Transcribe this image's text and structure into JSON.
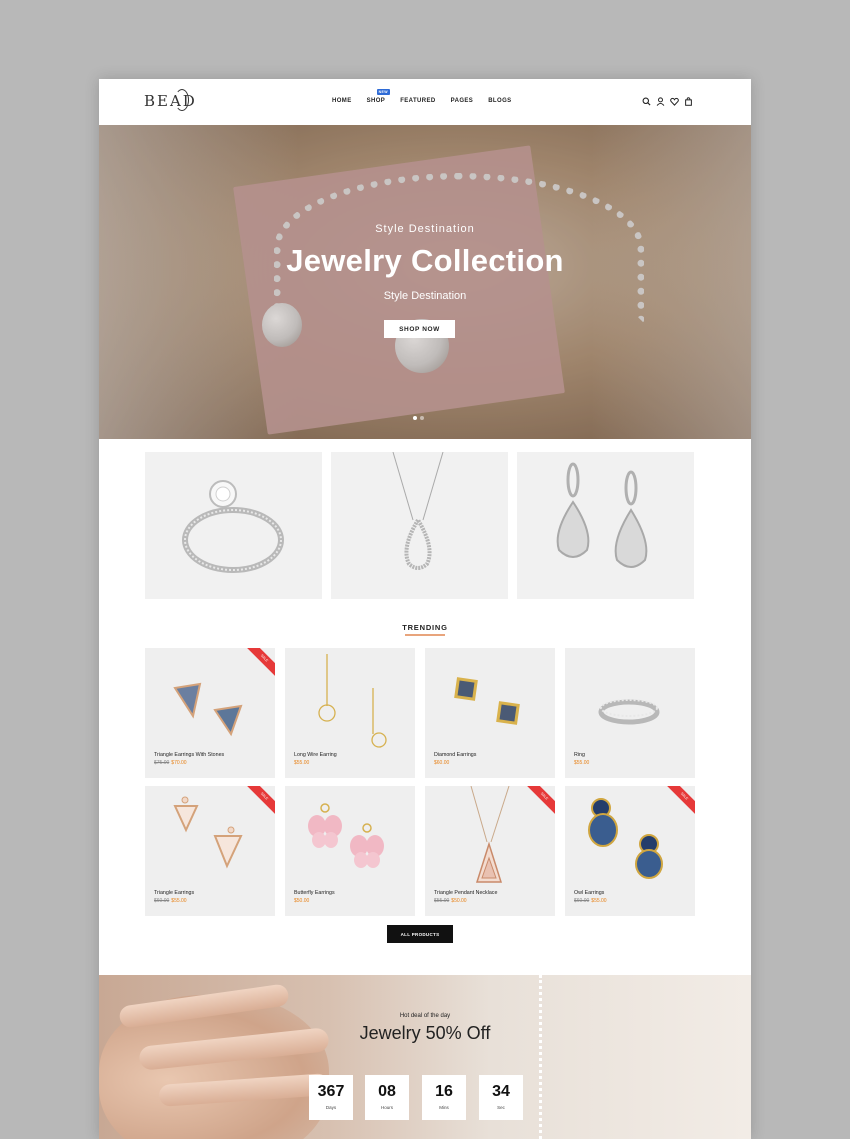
{
  "header": {
    "logo": "BEAD",
    "nav": [
      {
        "label": "HOME"
      },
      {
        "label": "SHOP",
        "badge": "NEW"
      },
      {
        "label": "FEATURED"
      },
      {
        "label": "PAGES"
      },
      {
        "label": "BLOGS"
      }
    ],
    "icons": [
      "search-icon",
      "user-icon",
      "heart-icon",
      "cart-icon"
    ]
  },
  "hero": {
    "kicker": "Style Destination",
    "title": "Jewelry Collection",
    "subtitle": "Style Destination",
    "button": "SHOP NOW",
    "slides": 2,
    "active_slide": 1
  },
  "categories": [
    "ring",
    "necklace",
    "earrings"
  ],
  "trending": {
    "title": "TRENDING",
    "products": [
      {
        "name": "Triangle Earrings With Stones",
        "old_price": "$75.00",
        "price": "$70.00",
        "sale": true
      },
      {
        "name": "Long Wire Earring",
        "old_price": "",
        "price": "$55.00",
        "sale": false
      },
      {
        "name": "Diamond Earrings",
        "old_price": "",
        "price": "$60.00",
        "sale": false
      },
      {
        "name": "Ring",
        "old_price": "",
        "price": "$55.00",
        "sale": false
      },
      {
        "name": "Triangle Earrings",
        "old_price": "$60.00",
        "price": "$55.00",
        "sale": true
      },
      {
        "name": "Butterfly Earrings",
        "old_price": "",
        "price": "$50.00",
        "sale": false
      },
      {
        "name": "Triangle Pendant Necklace",
        "old_price": "$55.00",
        "price": "$50.00",
        "sale": true
      },
      {
        "name": "Owl Earrings",
        "old_price": "$60.00",
        "price": "$55.00",
        "sale": true
      }
    ],
    "button": "ALL PRODUCTS"
  },
  "deal": {
    "kicker": "Hot deal of the day",
    "title": "Jewelry 50% Off",
    "countdown": [
      {
        "value": "367",
        "label": "Days"
      },
      {
        "value": "08",
        "label": "Hours"
      },
      {
        "value": "16",
        "label": "Mins"
      },
      {
        "value": "34",
        "label": "Sec"
      }
    ]
  },
  "colors": {
    "accent": "#e8831a",
    "badge": "#2e6bd6",
    "sale_ribbon": "#e63939",
    "button_dark": "#111111"
  }
}
